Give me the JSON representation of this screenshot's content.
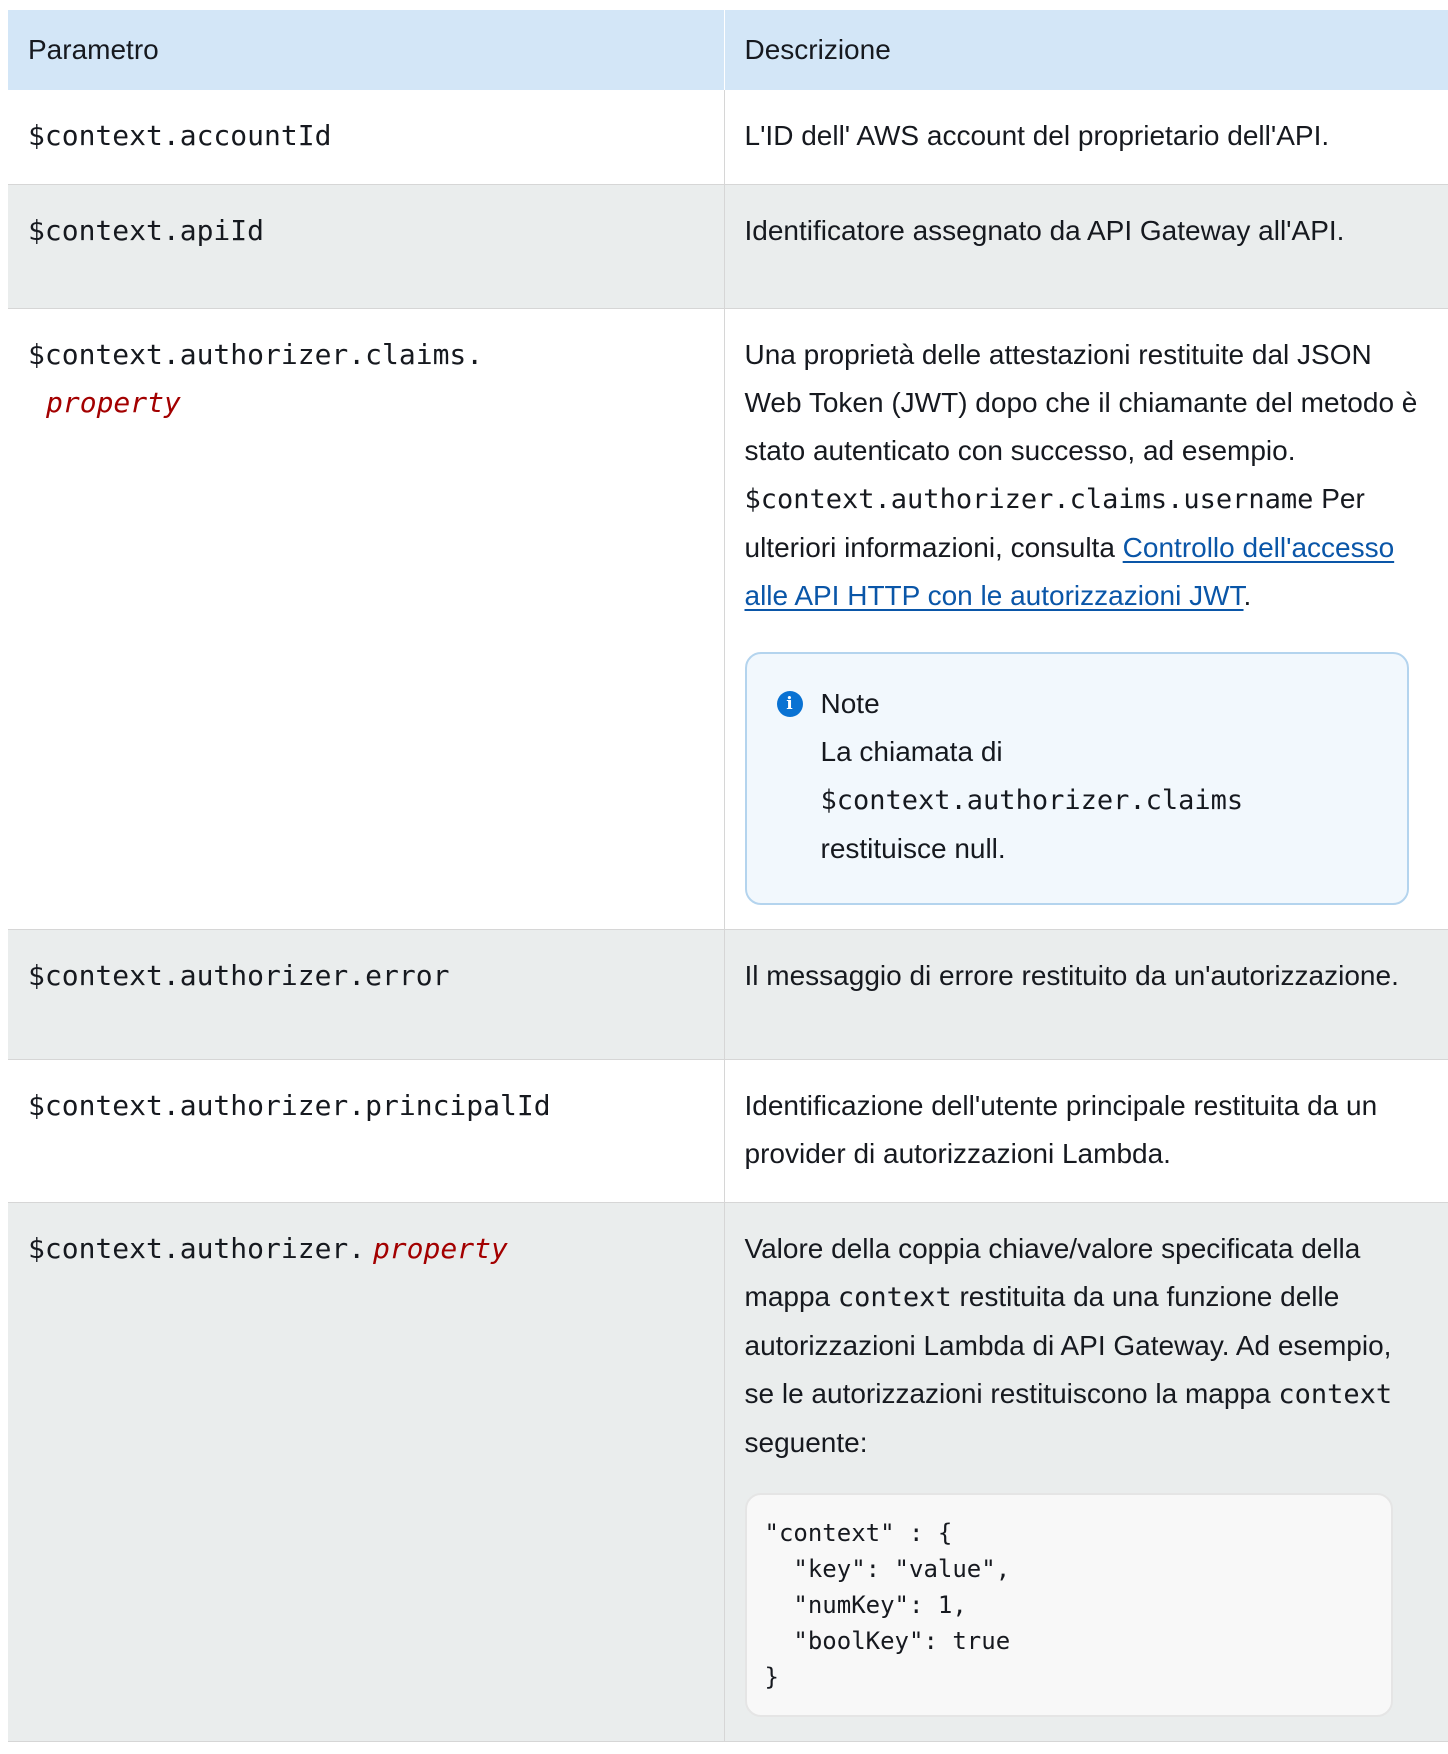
{
  "table": {
    "headers": [
      "Parametro",
      "Descrizione"
    ],
    "rows": {
      "r0": {
        "param": "$context.accountId",
        "desc": "L'ID dell' AWS account del proprietario dell'API."
      },
      "r1": {
        "param": "$context.apiId",
        "desc": "Identificatore assegnato da API Gateway all'API."
      },
      "r2": {
        "param_prefix": "$context.authorizer.claims.",
        "param_var": "property",
        "desc_text1": "Una proprietà delle attestazioni restituite dal JSON Web Token (JWT) dopo che il chiamante del metodo è stato autenticato con successo, ad esempio. ",
        "desc_code": "$context.authorizer.claims.username",
        "desc_text2": " Per ulteriori informazioni, consulta ",
        "desc_link": "Controllo dell'accesso alle API HTTP con le autorizzazioni JWT",
        "desc_text3": ".",
        "note_title": "Note",
        "note_text1": "La chiamata di ",
        "note_code": "$context.authorizer.claims",
        "note_text2": " restituisce null."
      },
      "r3": {
        "param": "$context.authorizer.error",
        "desc": "Il messaggio di errore restituito da un'autorizzazione."
      },
      "r4": {
        "param": "$context.authorizer.principalId",
        "desc": "Identificazione dell'utente principale restituita da un provider di autorizzazioni Lambda."
      },
      "r5": {
        "param_prefix": "$context.authorizer.",
        "param_var": "property",
        "desc_text1": "Valore della coppia chiave/valore specificata della mappa ",
        "desc_code1": "context",
        "desc_text2": " restituita da una funzione delle autorizzazioni Lambda di API Gateway. Ad esempio, se le autorizzazioni restituiscono la mappa ",
        "desc_code2": "context",
        "desc_text3": " seguente:",
        "code_block": "\"context\" : {\n  \"key\": \"value\",\n  \"numKey\": 1,\n  \"boolKey\": true\n}"
      }
    }
  }
}
